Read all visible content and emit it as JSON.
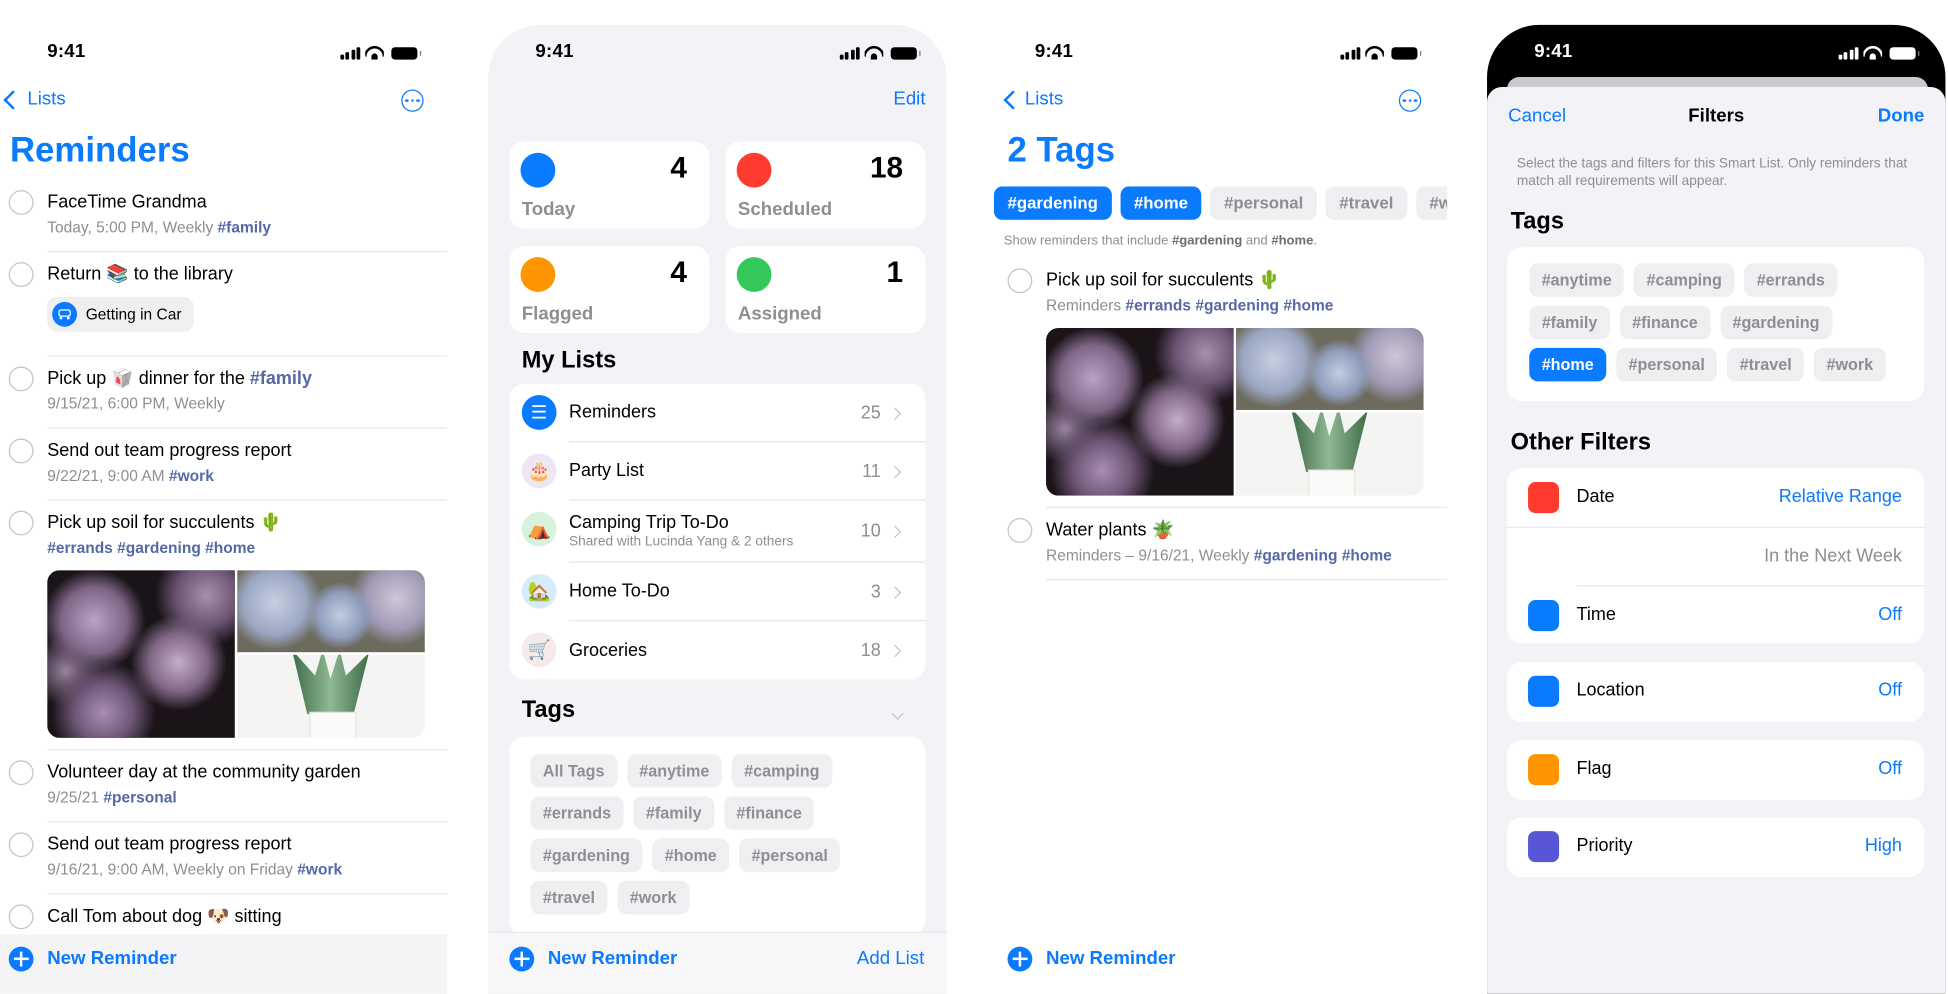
{
  "status_time": "9:41",
  "colors": {
    "accent": "#0a7aff",
    "tag": "#5668a6",
    "secondary": "#8e8e93",
    "background": "#f2f2f7"
  },
  "screen1": {
    "back": "Lists",
    "more_icon": "ellipsis-circle-icon",
    "title": "Reminders",
    "rows": [
      {
        "title": [
          {
            "t": "FaceTime Grandma"
          }
        ],
        "sub": [
          {
            "t": "Today, 5:00 PM, Weekly "
          },
          {
            "t": "#family",
            "tag": true
          }
        ]
      },
      {
        "title": [
          {
            "t": "Return 📚 to the library"
          }
        ],
        "chip": {
          "label": "Getting in Car",
          "icon": "car-icon"
        }
      },
      {
        "title": [
          {
            "t": "Pick up 🥡 dinner for the "
          },
          {
            "t": "#family",
            "tag": true
          }
        ],
        "sub": [
          {
            "t": "9/15/21, 6:00 PM, Weekly"
          }
        ]
      },
      {
        "title": [
          {
            "t": "Send out team progress report"
          }
        ],
        "sub": [
          {
            "t": "9/22/21, 9:00 AM "
          },
          {
            "t": "#work",
            "tag": true
          }
        ]
      },
      {
        "title": [
          {
            "t": "Pick up soil for succulents 🌵"
          }
        ],
        "sub": [
          {
            "t": "#errands #gardening #home",
            "tag": true
          }
        ],
        "images": true
      },
      {
        "title": [
          {
            "t": "Volunteer day at the community garden"
          }
        ],
        "sub": [
          {
            "t": "9/25/21 "
          },
          {
            "t": "#personal",
            "tag": true
          }
        ]
      },
      {
        "title": [
          {
            "t": "Send out team progress report"
          }
        ],
        "sub": [
          {
            "t": "9/16/21, 9:00 AM, Weekly on Friday "
          },
          {
            "t": "#work",
            "tag": true
          }
        ]
      },
      {
        "title": [
          {
            "t": "Call Tom about dog 🐶 sitting"
          }
        ]
      }
    ],
    "new_reminder": "New Reminder"
  },
  "screen2": {
    "edit": "Edit",
    "smart": [
      {
        "label": "Today",
        "count": "4",
        "color": "#0a7aff",
        "icon": "calendar-today-icon"
      },
      {
        "label": "Scheduled",
        "count": "18",
        "color": "#ff3b30",
        "icon": "calendar-grid-icon"
      },
      {
        "label": "Flagged",
        "count": "4",
        "color": "#ff9500",
        "icon": "flag-icon"
      },
      {
        "label": "Assigned",
        "count": "1",
        "color": "#34c759",
        "icon": "person-icon"
      }
    ],
    "my_lists_header": "My Lists",
    "lists": [
      {
        "name": "Reminders",
        "count": "25",
        "icon": "list-bullet-icon",
        "emoji": "☰",
        "bg": "#0a7aff"
      },
      {
        "name": "Party List",
        "count": "11",
        "icon": "birthday-cake-icon",
        "emoji": "🎂",
        "bg": "#efe6f5"
      },
      {
        "name": "Camping Trip To-Do",
        "sub": "Shared with Lucinda Yang & 2 others",
        "count": "10",
        "icon": "tent-icon",
        "emoji": "⛺",
        "bg": "#d8f3dd"
      },
      {
        "name": "Home To-Do",
        "count": "3",
        "icon": "house-icon",
        "emoji": "🏡",
        "bg": "#d6ebfb"
      },
      {
        "name": "Groceries",
        "count": "18",
        "icon": "shopping-cart-icon",
        "emoji": "🛒",
        "bg": "#f6e9e9"
      }
    ],
    "tags_header": "Tags",
    "tag_rows": [
      [
        "All Tags",
        "#anytime",
        "#camping"
      ],
      [
        "#errands",
        "#family",
        "#finance"
      ],
      [
        "#gardening",
        "#home",
        "#personal"
      ],
      [
        "#travel",
        "#work"
      ]
    ],
    "new_reminder": "New Reminder",
    "add_list": "Add List"
  },
  "screen3": {
    "back": "Lists",
    "title": "2 Tags",
    "chips": [
      {
        "label": "#gardening",
        "selected": true
      },
      {
        "label": "#home",
        "selected": true
      },
      {
        "label": "#personal",
        "selected": false
      },
      {
        "label": "#travel",
        "selected": false
      },
      {
        "label": "#wo",
        "selected": false
      }
    ],
    "helper": [
      {
        "t": "Show reminders that include "
      },
      {
        "t": "#gardening",
        "b": true
      },
      {
        "t": " and "
      },
      {
        "t": "#home",
        "b": true
      },
      {
        "t": "."
      }
    ],
    "rows": [
      {
        "title": [
          {
            "t": "Pick up soil for succulents 🌵"
          }
        ],
        "sub": [
          {
            "t": "Reminders "
          },
          {
            "t": "#errands #gardening #home",
            "tag": true
          }
        ],
        "images": true
      },
      {
        "title": [
          {
            "t": "Water plants 🪴"
          }
        ],
        "sub": [
          {
            "t": "Reminders – 9/16/21, Weekly "
          },
          {
            "t": "#gardening #home",
            "tag": true
          }
        ]
      }
    ],
    "new_reminder": "New Reminder"
  },
  "screen4": {
    "cancel": "Cancel",
    "title": "Filters",
    "done": "Done",
    "description": "Select the tags and filters for this Smart List. Only reminders that match all requirements will appear.",
    "tags_header": "Tags",
    "tag_rows": [
      [
        {
          "label": "#anytime"
        },
        {
          "label": "#camping"
        },
        {
          "label": "#errands"
        }
      ],
      [
        {
          "label": "#family"
        },
        {
          "label": "#finance"
        },
        {
          "label": "#gardening"
        }
      ],
      [
        {
          "label": "#home",
          "selected": true
        },
        {
          "label": "#personal"
        },
        {
          "label": "#travel"
        },
        {
          "label": "#work"
        }
      ]
    ],
    "other_header": "Other Filters",
    "date": {
      "label": "Date",
      "value": "Relative Range",
      "detail": "In the Next Week",
      "icon": "calendar-icon",
      "color": "#ff3b30"
    },
    "time": {
      "label": "Time",
      "value": "Off",
      "icon": "clock-icon",
      "color": "#0a7aff"
    },
    "location": {
      "label": "Location",
      "value": "Off",
      "icon": "location-arrow-icon",
      "color": "#0a7aff"
    },
    "flag": {
      "label": "Flag",
      "value": "Off",
      "icon": "flag-icon",
      "color": "#ff9500"
    },
    "priority": {
      "label": "Priority",
      "value": "High",
      "icon": "exclamation-icon",
      "color": "#5856d6"
    }
  }
}
